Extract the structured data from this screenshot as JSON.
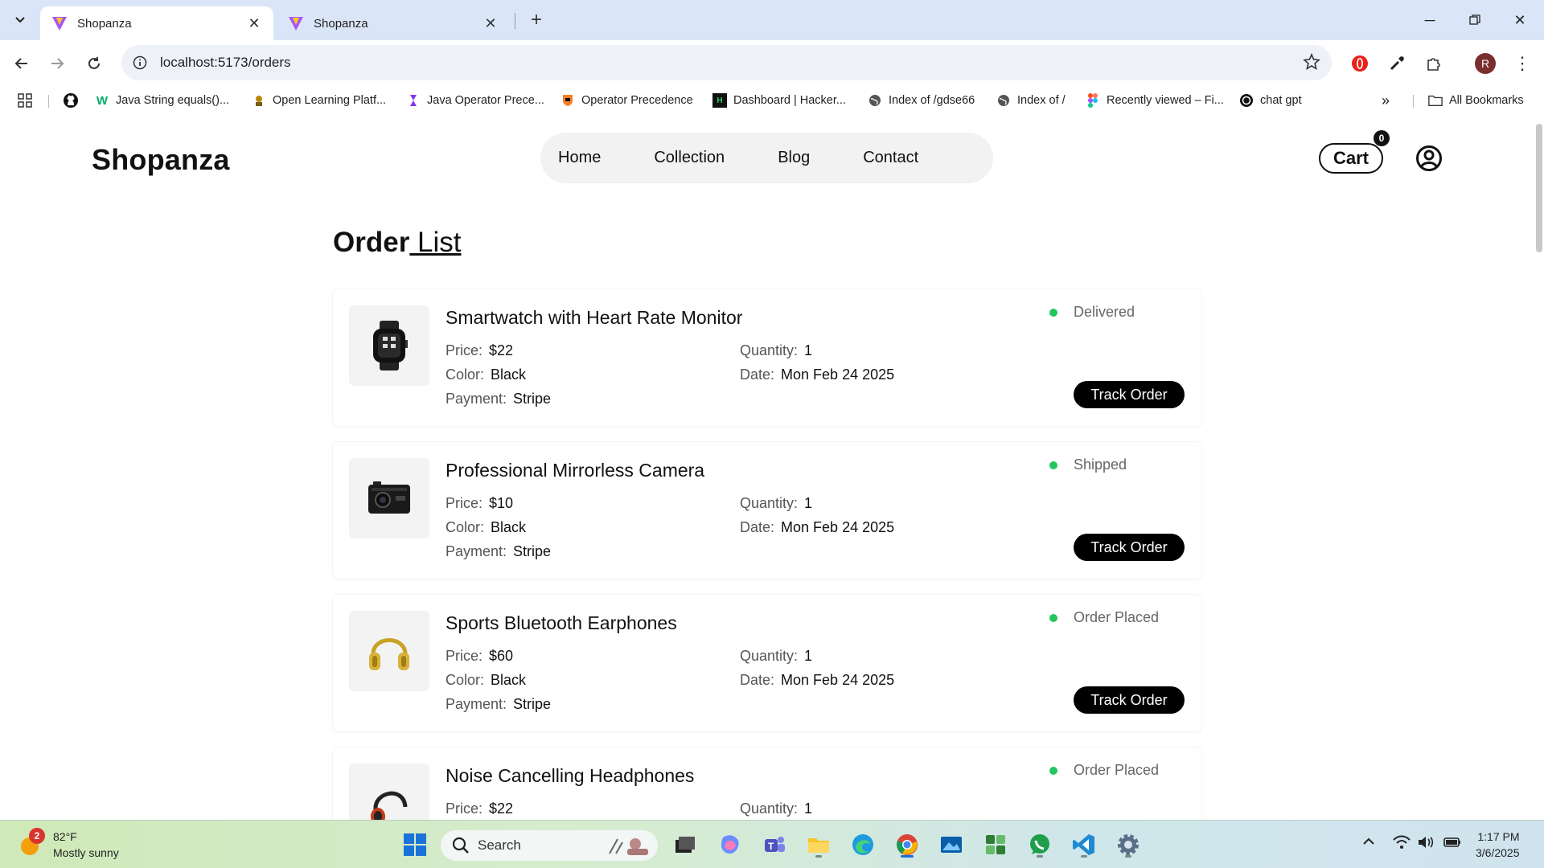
{
  "browser": {
    "tabs": [
      {
        "title": "Shopanza",
        "active": true
      },
      {
        "title": "Shopanza",
        "active": false
      }
    ],
    "url": "localhost:5173/orders",
    "profile_initial": "R",
    "bookmarks": [
      {
        "label": "Java String equals()...",
        "icon": "w3schools-icon"
      },
      {
        "label": "Open Learning Platf...",
        "icon": "open-learning-icon"
      },
      {
        "label": "Java Operator Prece...",
        "icon": "java-operator-icon"
      },
      {
        "label": "Operator Precedence",
        "icon": "princeton-icon"
      },
      {
        "label": "Dashboard | Hacker...",
        "icon": "hackerrank-icon"
      },
      {
        "label": "Index of /gdse66",
        "icon": "globe-icon"
      },
      {
        "label": "Index of /",
        "icon": "globe-icon"
      },
      {
        "label": "Recently viewed – Fi...",
        "icon": "figma-icon"
      },
      {
        "label": "chat gpt",
        "icon": "openai-icon"
      }
    ],
    "all_bookmarks": "All Bookmarks"
  },
  "site": {
    "brand": "Shopanza",
    "nav": [
      "Home",
      "Collection",
      "Blog",
      "Contact"
    ],
    "cart_label": "Cart",
    "cart_count": "0"
  },
  "page": {
    "heading_strong": "Order",
    "heading_light": " List"
  },
  "labels": {
    "price": "Price:",
    "color": "Color:",
    "payment": "Payment:",
    "quantity": "Quantity:",
    "date": "Date:",
    "track": "Track Order"
  },
  "orders": [
    {
      "name": "Smartwatch with Heart Rate Monitor",
      "price": "$22",
      "color": "Black",
      "payment": "Stripe",
      "quantity": "1",
      "date": "Mon Feb 24 2025",
      "status": "Delivered",
      "image": "smartwatch-image"
    },
    {
      "name": "Professional Mirrorless Camera",
      "price": "$10",
      "color": "Black",
      "payment": "Stripe",
      "quantity": "1",
      "date": "Mon Feb 24 2025",
      "status": "Shipped",
      "image": "camera-image"
    },
    {
      "name": "Sports Bluetooth Earphones",
      "price": "$60",
      "color": "Black",
      "payment": "Stripe",
      "quantity": "1",
      "date": "Mon Feb 24 2025",
      "status": "Order Placed",
      "image": "gold-headphones-image"
    },
    {
      "name": "Noise Cancelling Headphones",
      "price": "$22",
      "color": "",
      "payment": "",
      "quantity": "1",
      "date": "",
      "status": "Order Placed",
      "image": "headphones-image"
    }
  ],
  "status_color": "#22c55e",
  "taskbar": {
    "weather_temp": "82°F",
    "weather_desc": "Mostly sunny",
    "weather_badge": "2",
    "search_placeholder": "Search",
    "time": "1:17 PM",
    "date": "3/6/2025"
  }
}
